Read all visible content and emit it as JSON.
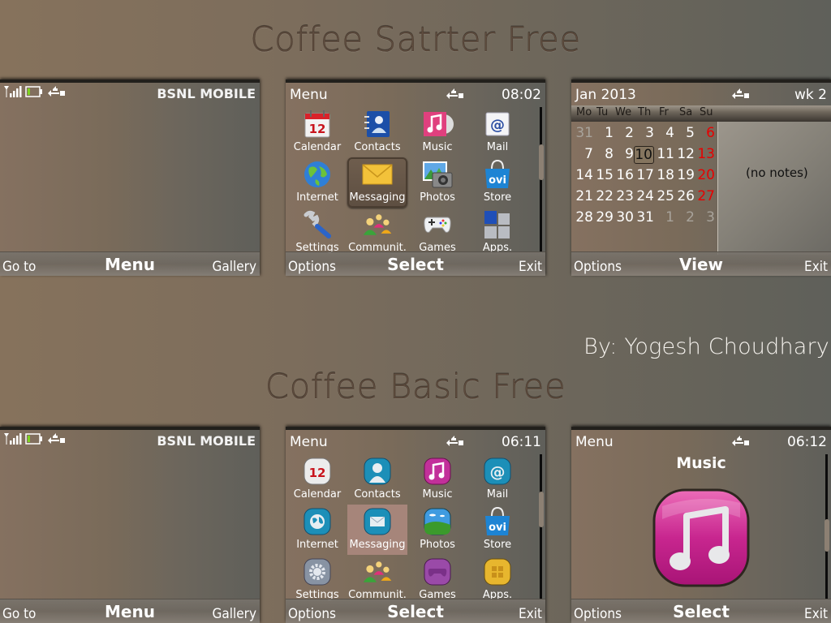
{
  "banners": {
    "top": "Coffee Satrter Free",
    "bottom": "Coffee Basic Free",
    "author": "By: Yogesh Choudhary"
  },
  "colors": {
    "sunday_red": "#e80000",
    "battery_green": "#7dd320",
    "banner_text": "#5e4c3e"
  },
  "standby_starter": {
    "operator": "BSNL MOBILE",
    "status_icons": [
      "signal-icon",
      "battery-icon",
      "usb-connection-icon"
    ],
    "softkeys": {
      "left": "Go to",
      "center": "Menu",
      "right": "Gallery"
    }
  },
  "menu_starter": {
    "title": "Menu",
    "time": "08:02",
    "selected": "Messaging",
    "items": [
      {
        "label": "Calendar",
        "icon": "calendar-icon"
      },
      {
        "label": "Contacts",
        "icon": "contacts-icon"
      },
      {
        "label": "Music",
        "icon": "music-icon"
      },
      {
        "label": "Mail",
        "icon": "mail-icon"
      },
      {
        "label": "Internet",
        "icon": "globe-icon"
      },
      {
        "label": "Messaging",
        "icon": "envelope-icon"
      },
      {
        "label": "Photos",
        "icon": "camera-icon"
      },
      {
        "label": "Store",
        "icon": "ovi-store-icon"
      },
      {
        "label": "Settings",
        "icon": "wrench-icon"
      },
      {
        "label": "Communit.",
        "icon": "community-icon"
      },
      {
        "label": "Games",
        "icon": "gamepad-icon"
      },
      {
        "label": "Apps.",
        "icon": "apps-icon"
      }
    ],
    "calendar_icon_day": "12",
    "store_icon_text": "ovi",
    "softkeys": {
      "left": "Options",
      "center": "Select",
      "right": "Exit"
    }
  },
  "calendar": {
    "month": "Jan 2013",
    "week": "wk 2",
    "weekdays": [
      "Mo",
      "Tu",
      "We",
      "Th",
      "Fr",
      "Sa",
      "Su"
    ],
    "weeks": [
      [
        "31",
        "1",
        "2",
        "3",
        "4",
        "5",
        "6"
      ],
      [
        "7",
        "8",
        "9",
        "10",
        "11",
        "12",
        "13"
      ],
      [
        "14",
        "15",
        "16",
        "17",
        "18",
        "19",
        "20"
      ],
      [
        "21",
        "22",
        "23",
        "24",
        "25",
        "26",
        "27"
      ],
      [
        "28",
        "29",
        "30",
        "31",
        "1",
        "2",
        "3"
      ]
    ],
    "muted_days": [
      "0-0",
      "4-4",
      "4-5",
      "4-6"
    ],
    "today": "10",
    "notes": "(no notes)",
    "softkeys": {
      "left": "Options",
      "center": "View",
      "right": "Exit"
    }
  },
  "standby_basic": {
    "operator": "BSNL MOBILE",
    "status_icons": [
      "signal-icon",
      "battery-icon",
      "usb-connection-icon"
    ],
    "softkeys": {
      "left": "Go to",
      "center": "Menu",
      "right": "Gallery"
    }
  },
  "menu_basic": {
    "title": "Menu",
    "time": "06:11",
    "selected": "Messaging",
    "items": [
      {
        "label": "Calendar",
        "icon": "calendar-icon"
      },
      {
        "label": "Contacts",
        "icon": "contacts-icon"
      },
      {
        "label": "Music",
        "icon": "music-icon"
      },
      {
        "label": "Mail",
        "icon": "mail-icon"
      },
      {
        "label": "Internet",
        "icon": "globe-icon"
      },
      {
        "label": "Messaging",
        "icon": "envelope-icon"
      },
      {
        "label": "Photos",
        "icon": "landscape-icon"
      },
      {
        "label": "Store",
        "icon": "ovi-store-icon"
      },
      {
        "label": "Settings",
        "icon": "gear-icon"
      },
      {
        "label": "Communit.",
        "icon": "community-icon"
      },
      {
        "label": "Games",
        "icon": "gamepad-icon"
      },
      {
        "label": "Apps.",
        "icon": "apps-icon"
      }
    ],
    "calendar_icon_day": "12",
    "store_icon_text": "ovi",
    "softkeys": {
      "left": "Options",
      "center": "Select",
      "right": "Exit"
    }
  },
  "music_screen": {
    "title": "Menu",
    "time": "06:12",
    "item_label": "Music",
    "icon": "music-note-icon",
    "softkeys": {
      "left": "Options",
      "center": "Select",
      "right": "Exit"
    }
  }
}
